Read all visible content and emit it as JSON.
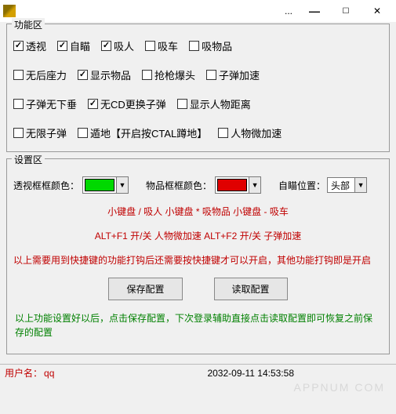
{
  "window": {
    "dots": "...",
    "min": "—",
    "max": "☐",
    "close": "✕"
  },
  "group1": {
    "title": "功能区",
    "rows": [
      [
        {
          "label": "透视",
          "checked": true
        },
        {
          "label": "自瞄",
          "checked": true
        },
        {
          "label": "吸人",
          "checked": true
        },
        {
          "label": "吸车",
          "checked": false
        },
        {
          "label": "吸物品",
          "checked": false
        }
      ],
      [
        {
          "label": "无后座力",
          "checked": false
        },
        {
          "label": "显示物品",
          "checked": true
        },
        {
          "label": "抢枪爆头",
          "checked": false
        },
        {
          "label": "子弹加速",
          "checked": false
        }
      ],
      [
        {
          "label": "子弹无下垂",
          "checked": false
        },
        {
          "label": "无CD更换子弹",
          "checked": true
        },
        {
          "label": "显示人物距离",
          "checked": false
        }
      ],
      [
        {
          "label": "无限子弹",
          "checked": false
        },
        {
          "label": "遁地【开启按CTAL蹲地】",
          "checked": false
        },
        {
          "label": "人物微加速",
          "checked": false
        }
      ]
    ]
  },
  "group2": {
    "title": "设置区",
    "label1": "透视框框颜色：",
    "color1": "#00d800",
    "label2": "物品框框颜色：",
    "color2": "#e00000",
    "label3": "自瞄位置：",
    "dropdown_value": "头部",
    "arrow": "▼",
    "hint1": "小键盘 / 吸人    小键盘 * 吸物品   小键盘 - 吸车",
    "hint2": "ALT+F1 开/关 人物微加速    ALT+F2 开/关 子弹加速",
    "hint3": "以上需要用到快捷键的功能打钩后还需要按快捷键才可以开启，其他功能打钩即是开启",
    "btn_save": "保存配置",
    "btn_load": "读取配置",
    "hint4": "以上功能设置好以后，点击保存配置，下次登录辅助直接点击读取配置即可恢复之前保存的配置"
  },
  "status": {
    "user_label": "用户名：",
    "user_val": "qq",
    "time": "2032-09-11 14:53:58"
  },
  "watermark": "APPNUM COM"
}
